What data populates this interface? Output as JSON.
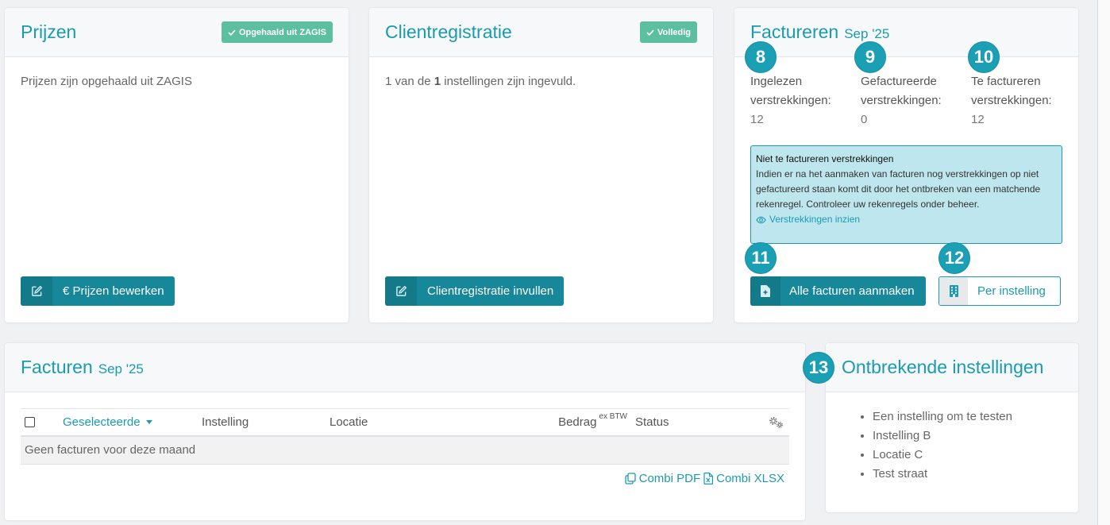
{
  "colors": {
    "accent": "#1a9bb0",
    "button": "#17889a",
    "button_icon": "#137a89",
    "badge": "#5cbf9f",
    "marker": "#1b9fb4",
    "notice_bg": "#bee6ee"
  },
  "prijzen": {
    "title": "Prijzen",
    "badge": {
      "icon": "check-icon",
      "label": "Opgehaald uit ZAGIS"
    },
    "body": "Prijzen zijn opgehaald uit ZAGIS",
    "button": {
      "icon": "edit-icon",
      "label": "€ Prijzen bewerken"
    }
  },
  "clientregistratie": {
    "title": "Clientregistratie",
    "badge": {
      "icon": "check-icon",
      "label": "Volledig"
    },
    "body": {
      "count": "1",
      "connector": "van de",
      "total": "1",
      "suffix": "instellingen zijn ingevuld."
    },
    "button": {
      "icon": "edit-icon",
      "label": "Clientregistratie invullen"
    }
  },
  "factureren": {
    "title": "Factureren",
    "period": "Sep '25",
    "stats": [
      {
        "marker": "8",
        "label": "Ingelezen verstrekkingen:",
        "value": "12"
      },
      {
        "marker": "9",
        "label": "Gefactureerde verstrekkingen:",
        "value": "0"
      },
      {
        "marker": "10",
        "label": "Te factureren verstrekkingen:",
        "value": "12"
      }
    ],
    "notice": {
      "title": "Niet te factureren verstrekkingen",
      "text": "Indien er na het aanmaken van facturen nog verstrekkingen op niet gefactureerd staan komt dit door het ontbreken van een matchende rekenregel. Controleer uw rekenregels onder beheer.",
      "link": {
        "icon": "eye-icon",
        "label": "Verstrekkingen inzien"
      }
    },
    "buttons": [
      {
        "marker": "11",
        "icon": "file-plus-icon",
        "label": "Alle facturen aanmaken"
      },
      {
        "marker": "12",
        "icon": "building-icon",
        "label": "Per instelling"
      }
    ]
  },
  "facturen": {
    "title": "Facturen",
    "period": "Sep '25",
    "table": {
      "columns": {
        "select": {
          "label": "Geselecteerde",
          "icon": "caret-down-icon"
        },
        "instelling": "Instelling",
        "locatie": "Locatie",
        "bedrag": {
          "label": "Bedrag",
          "suffix": "ex BTW"
        },
        "status": "Status",
        "settings_icon": "gears-icon"
      },
      "empty_message": "Geen facturen voor deze maand"
    },
    "exports": [
      {
        "icon": "copy-icon",
        "label": "Combi PDF"
      },
      {
        "icon": "file-excel-icon",
        "label": "Combi XLSX"
      }
    ]
  },
  "ontbrekende": {
    "marker": "13",
    "title": "Ontbrekende instellingen",
    "items": [
      "Een instelling om te testen",
      "Instelling B",
      "Locatie C",
      "Test straat"
    ]
  }
}
